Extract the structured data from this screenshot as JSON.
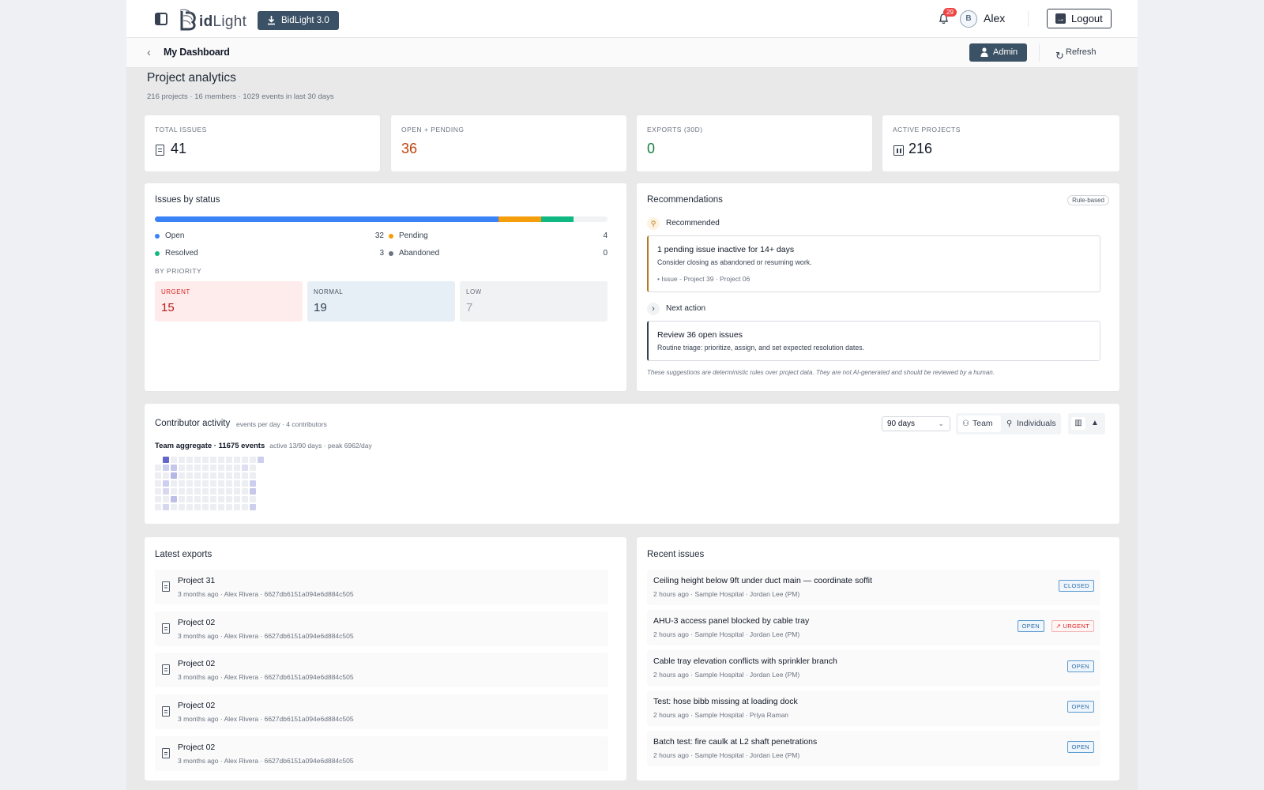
{
  "app": {
    "logo_text_bold": "id",
    "logo_text_light": "Light",
    "version_label": "BidLight 3.0"
  },
  "user": {
    "name": "Alex",
    "avatar_initials": "B",
    "notifications": "29",
    "logout_label": "Logout"
  },
  "breadcrumb": {
    "title": "My Dashboard"
  },
  "actions": {
    "admin_label": "Admin",
    "refresh_label": "Refresh"
  },
  "page": {
    "title": "Project analytics",
    "subtitle": "216 projects · 16 members · 1029 events in last 30 days"
  },
  "stats": [
    {
      "label": "TOTAL ISSUES",
      "value": "41",
      "color": "#111827"
    },
    {
      "label": "OPEN + PENDING",
      "value": "36",
      "color": "#c2410c"
    },
    {
      "label": "EXPORTS (30D)",
      "value": "0",
      "color": "#15803d"
    },
    {
      "label": "ACTIVE PROJECTS",
      "value": "216",
      "color": "#111827"
    }
  ],
  "issues_by_status": {
    "title": "Issues by status",
    "segments": [
      {
        "name": "Open",
        "value": 32,
        "color": "#3b82f6"
      },
      {
        "name": "Pending",
        "value": 4,
        "color": "#f59e0b"
      },
      {
        "name": "Resolved",
        "value": 3,
        "color": "#10b981"
      },
      {
        "name": "Abandoned",
        "value": 0,
        "color": "#6b7280"
      }
    ],
    "legend": [
      {
        "label": "Open",
        "count": "32"
      },
      {
        "label": "Pending",
        "count": "4"
      },
      {
        "label": "Resolved",
        "count": "3"
      },
      {
        "label": "Abandoned",
        "count": "0"
      }
    ],
    "by_priority_label": "BY PRIORITY",
    "priority": [
      {
        "label": "URGENT",
        "value": "15"
      },
      {
        "label": "NORMAL",
        "value": "19"
      },
      {
        "label": "LOW",
        "value": "7"
      }
    ]
  },
  "recommendations": {
    "title": "Recommendations",
    "chip": "Rule-based",
    "recommended_label": "Recommended",
    "recommended": {
      "title": "1 pending issue inactive for 14+ days",
      "desc": "Consider closing as abandoned or resuming work.",
      "meta": "• Issue - Project 39 · Project 06"
    },
    "next_label": "Next action",
    "next": {
      "title": "Review 36 open issues",
      "desc": "Routine triage: prioritize, assign, and set expected resolution dates."
    },
    "disclaimer": "These suggestions are deterministic rules over project data. They are not AI-generated and should be reviewed by a human."
  },
  "activity": {
    "title": "Contributor activity",
    "subtitle": "events per day · 4 contributors",
    "range": "90 days",
    "team_label": "Team",
    "individuals_label": "Individuals",
    "aggregate_bold": "Team aggregate · 11675 events",
    "aggregate_meta": "active 13/90 days · peak 6962/day",
    "accent": "#5b5fc7"
  },
  "exports": {
    "title": "Latest exports",
    "items": [
      {
        "name": "Project 31",
        "meta": "3 months ago · Alex Rivera · 6627db6151a094e6d884c505"
      },
      {
        "name": "Project 02",
        "meta": "3 months ago · Alex Rivera · 6627db6151a094e6d884c505"
      },
      {
        "name": "Project 02",
        "meta": "3 months ago · Alex Rivera · 6627db6151a094e6d884c505"
      },
      {
        "name": "Project 02",
        "meta": "3 months ago · Alex Rivera · 6627db6151a094e6d884c505"
      },
      {
        "name": "Project 02",
        "meta": "3 months ago · Alex Rivera · 6627db6151a094e6d884c505"
      }
    ]
  },
  "issues": {
    "title": "Recent issues",
    "items": [
      {
        "name": "Ceiling height below 9ft under duct main — coordinate soffit",
        "meta": "2 hours ago · Sample Hospital · Jordan Lee (PM)",
        "status": "CLOSED",
        "priority": ""
      },
      {
        "name": "AHU-3 access panel blocked by cable tray",
        "meta": "2 hours ago · Sample Hospital · Jordan Lee (PM)",
        "status": "OPEN",
        "priority": "URGENT"
      },
      {
        "name": "Cable tray elevation conflicts with sprinkler branch",
        "meta": "2 hours ago · Sample Hospital · Jordan Lee (PM)",
        "status": "OPEN",
        "priority": ""
      },
      {
        "name": "Test: hose bibb missing at loading dock",
        "meta": "2 hours ago · Sample Hospital · Priya Raman",
        "status": "OPEN",
        "priority": ""
      },
      {
        "name": "Batch test: fire caulk at L2 shaft penetrations",
        "meta": "2 hours ago · Sample Hospital · Jordan Lee (PM)",
        "status": "OPEN",
        "priority": ""
      }
    ]
  }
}
